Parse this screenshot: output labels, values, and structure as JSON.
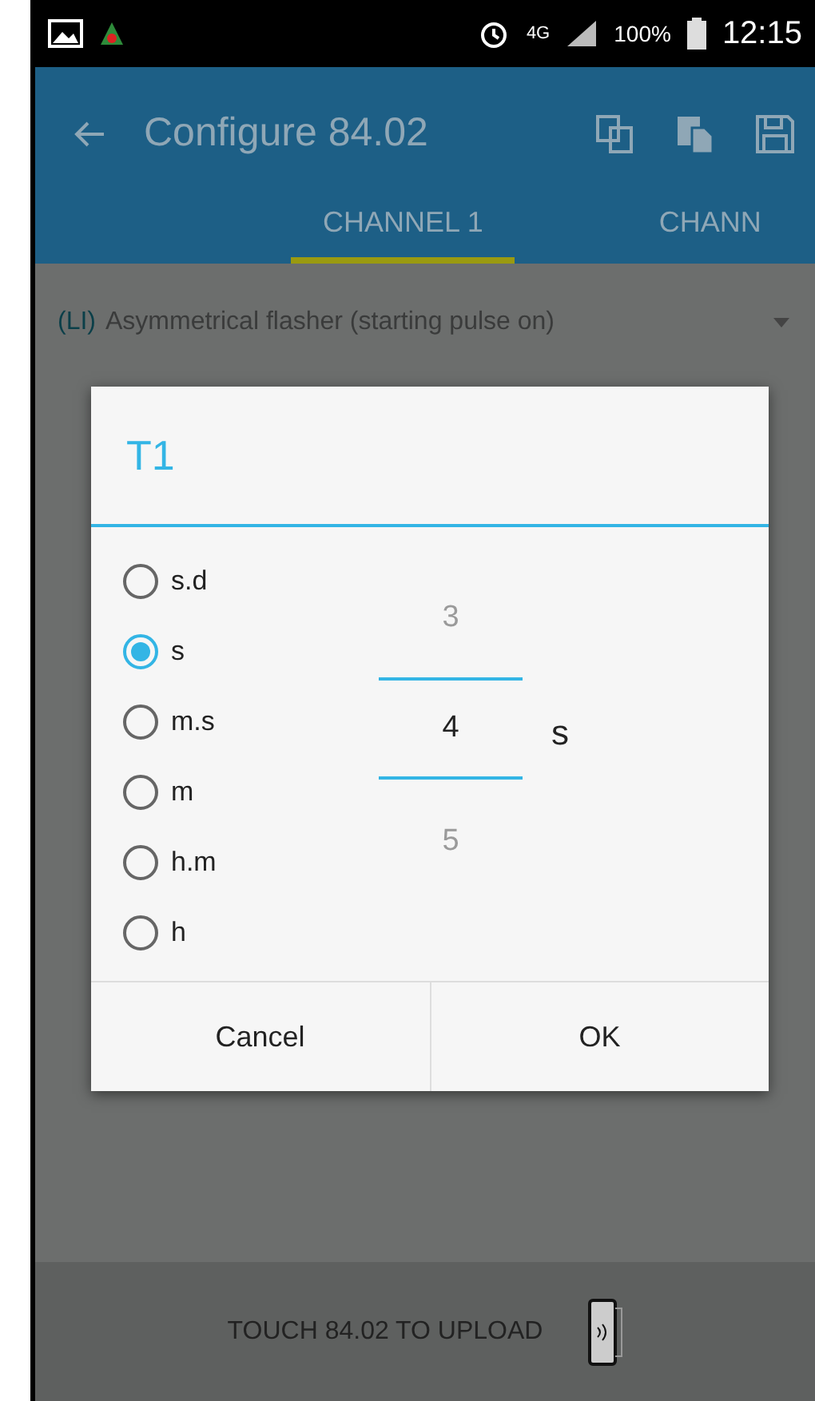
{
  "status_bar": {
    "network": "4G",
    "battery": "100%",
    "time": "12:15"
  },
  "app_bar": {
    "title": "Configure 84.02"
  },
  "tabs": [
    {
      "label": "CHANNEL 1",
      "selected": true
    },
    {
      "label": "CHANN",
      "selected": false
    }
  ],
  "function_select": {
    "code": "(LI)",
    "value": "Asymmetrical flasher (starting pulse on)"
  },
  "dialog": {
    "title": "T1",
    "units": [
      {
        "label": "s.d",
        "selected": false
      },
      {
        "label": "s",
        "selected": true
      },
      {
        "label": "m.s",
        "selected": false
      },
      {
        "label": "m",
        "selected": false
      },
      {
        "label": "h.m",
        "selected": false
      },
      {
        "label": "h",
        "selected": false
      }
    ],
    "picker": {
      "previous": "3",
      "current": "4",
      "next": "5",
      "unit": "s"
    },
    "buttons": [
      "Cancel",
      "OK"
    ]
  },
  "footer": {
    "text": "TOUCH 84.02 TO UPLOAD"
  }
}
